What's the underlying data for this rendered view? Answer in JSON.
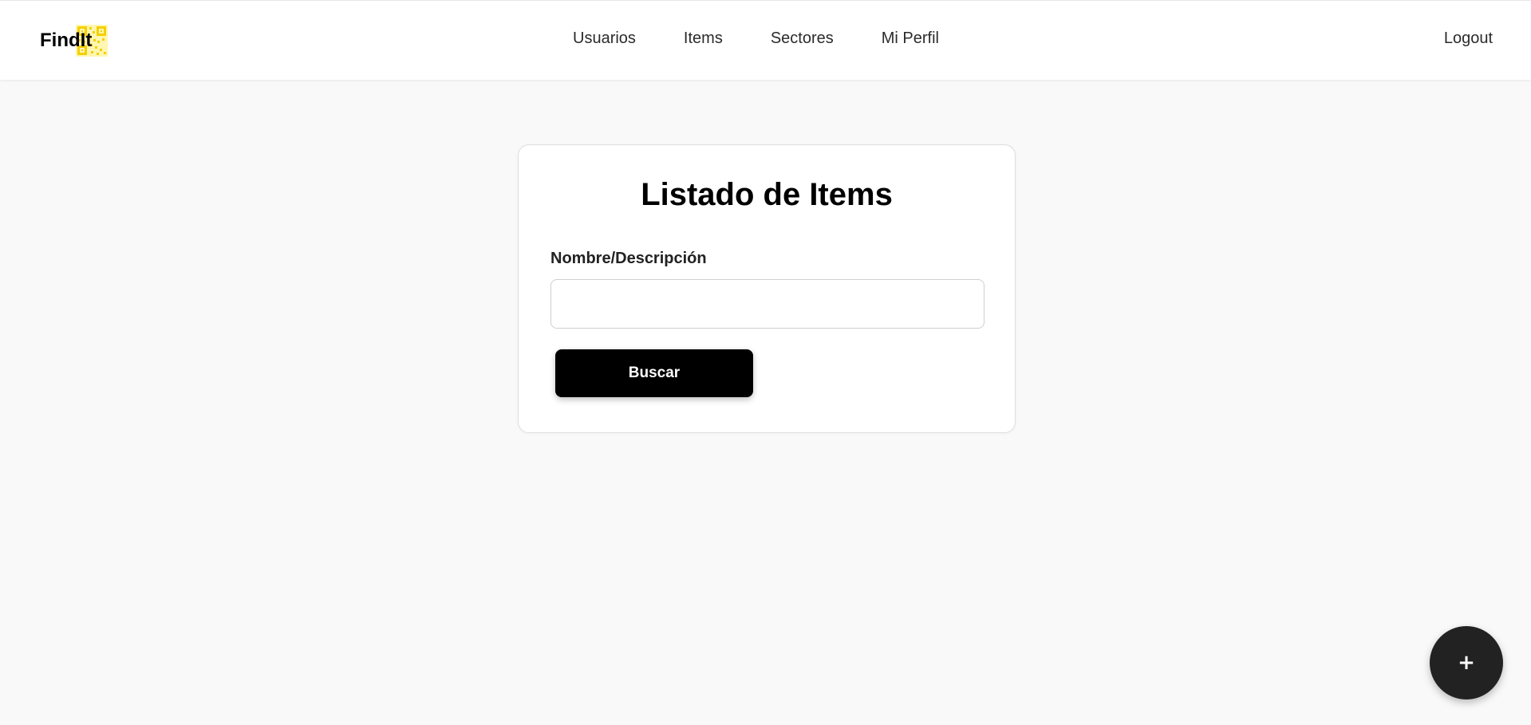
{
  "brand": {
    "name": "FindIt",
    "logo_icon": "qr-code-icon",
    "logo_color": "#f5d000"
  },
  "nav": {
    "items": [
      {
        "label": "Usuarios"
      },
      {
        "label": "Items"
      },
      {
        "label": "Sectores"
      },
      {
        "label": "Mi Perfil"
      }
    ],
    "logout_label": "Logout"
  },
  "search_card": {
    "title": "Listado de Items",
    "field_label": "Nombre/Descripción",
    "field_value": "",
    "field_placeholder": "",
    "button_label": "Buscar"
  },
  "fab": {
    "icon": "plus-icon",
    "label": "+"
  },
  "colors": {
    "background": "#f9f9f9",
    "primary_button": "#000000",
    "fab": "#222222"
  }
}
